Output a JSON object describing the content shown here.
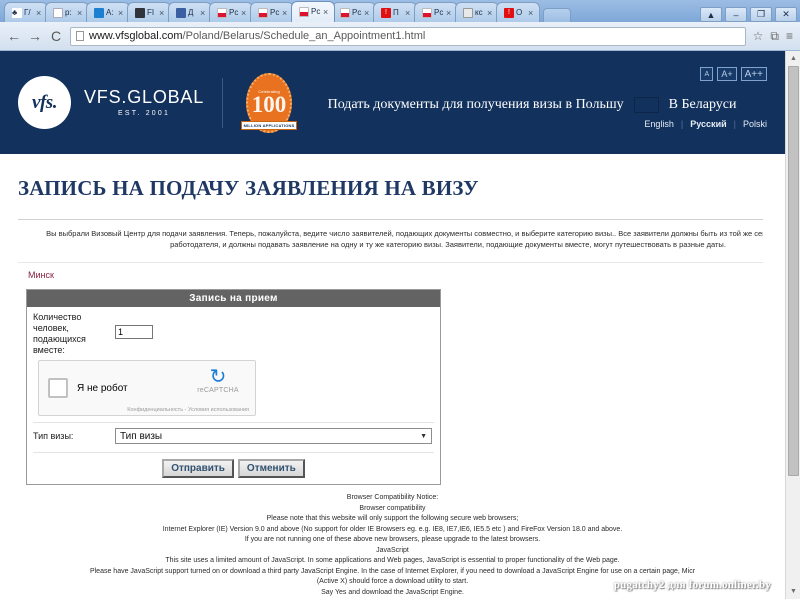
{
  "browser": {
    "tabs": [
      {
        "label": "Г/",
        "favicon": "purple-icon",
        "active": false
      },
      {
        "label": "p:",
        "favicon": "document-icon",
        "active": false
      },
      {
        "label": "A:",
        "favicon": "blue-circle-icon",
        "active": false
      },
      {
        "label": "FI",
        "favicon": "dark-circle-icon",
        "active": false
      },
      {
        "label": "Д",
        "favicon": "blue-square-icon",
        "active": false
      },
      {
        "label": "Pc",
        "favicon": "poland-flag-icon",
        "active": false
      },
      {
        "label": "Pc",
        "favicon": "poland-flag-icon",
        "active": false
      },
      {
        "label": "Pc",
        "favicon": "poland-flag-icon",
        "active": true
      },
      {
        "label": "Pc",
        "favicon": "poland-flag-icon",
        "active": false
      },
      {
        "label": "П",
        "favicon": "red-icon",
        "active": false
      },
      {
        "label": "Pc",
        "favicon": "poland-flag-icon",
        "active": false
      },
      {
        "label": "кс",
        "favicon": "gray-icon",
        "active": false
      },
      {
        "label": "O",
        "favicon": "red-icon",
        "active": false
      }
    ],
    "tab_close": "×",
    "new_tab_label": "",
    "window_controls": [
      {
        "name": "user-profile-button",
        "glyph": "▲"
      },
      {
        "name": "minimize-button",
        "glyph": "–"
      },
      {
        "name": "restore-button",
        "glyph": "❐"
      },
      {
        "name": "close-button",
        "glyph": "✕"
      }
    ],
    "nav": {
      "back": "←",
      "forward": "→",
      "reload": "C",
      "bookmark": "☆",
      "extension": "⧉",
      "menu": "≡"
    },
    "url": {
      "host": "www.vfsglobal.com",
      "path": "/Poland/Belarus/Schedule_an_Appointment1.html"
    }
  },
  "site_header": {
    "logo_mark": "vfs.",
    "logo_word": "VFS.GLOBAL",
    "logo_est": "EST. 2001",
    "badge": {
      "top_line": "Celebrating",
      "number": "100",
      "ribbon": "MILLION APPLICATIONS"
    },
    "tagline": "Подать документы для получения визы в Польшу",
    "country": "В Беларуси",
    "font_sizes": [
      "A",
      "A+",
      "A++"
    ],
    "languages": [
      "English",
      "Русский",
      "Polski"
    ],
    "lang_separator": "|"
  },
  "content": {
    "page_title": "ЗАПИСЬ НА ПОДАЧУ ЗАЯВЛЕНИЯ НА ВИЗУ",
    "notice": "Вы выбрали Визовый Центр для подачи заявления. Теперь, пожалуйста, ведите число заявителей, подающих документы совместно, и выберите категорию визы.. Все заявители должны быть из той же семьи, или работать на того же работодателя, и должны подавать заявление на одну и ту же категорию визы. Заявители, подающие документы вместе, могут путешествовать в разные даты.",
    "city": "Минск"
  },
  "form": {
    "title": "Запись на прием",
    "qty_label": "Количество человек, подающихся вместе:",
    "qty_value": "1",
    "recaptcha": {
      "label": "Я не робот",
      "brand": "reCAPTCHA",
      "terms": "Конфиденциальность - Условия использования"
    },
    "visatype_label": "Тип визы:",
    "visatype_value": "Тип визы",
    "submit_label": "Отправить",
    "cancel_label": "Отменить"
  },
  "footer_notice": {
    "lines": [
      "Browser Compatibility Notice:",
      "Browser compatibility",
      "Please note that this website will only support the following secure web browsers;",
      "Internet Explorer (IE) Version 9.0 and above (No support for older IE Browsers eg. e.g. IE8, IE7,IE6, IE5.5 etc ) and FireFox Version 18.0 and above.",
      "If you are not running one of these above new browsers, please upgrade to the latest browsers.",
      "JavaScript",
      "This site uses a limited amount of JavaScript. In some applications and Web pages, JavaScript is essential to proper functionality of the Web page.",
      "Please have JavaScript support turned on or download a third party JavaScript Engine. In the case of Internet Explorer, if you need to download a JavaScript Engine for use on a certain page, Micr",
      "(Active X) should force a download utility to start.",
      "Say Yes and download the JavaScript Engine."
    ]
  },
  "watermark": "pugatchy2 для forum.onliner.by",
  "colors": {
    "header_navy": "#12315c",
    "title_blue": "#1f3864",
    "badge_orange": "#e8721f",
    "city_maroon": "#8a2040",
    "table_header_gray": "#636363",
    "flag_red": "#dc1430"
  }
}
